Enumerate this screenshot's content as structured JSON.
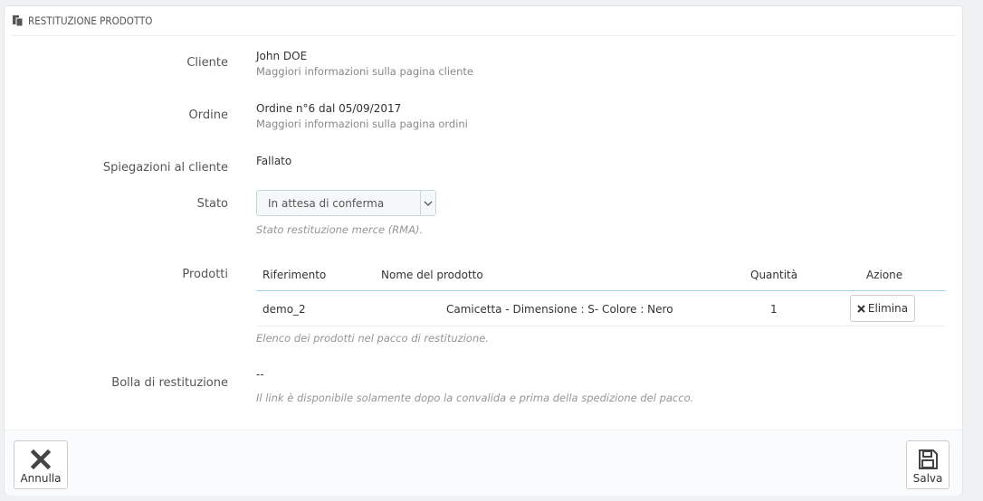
{
  "panel": {
    "title": "RESTITUZIONE PRODOTTO",
    "icon": "copy-icon"
  },
  "customer": {
    "label": "Cliente",
    "name": "John DOE",
    "link": "Maggiori informazioni sulla pagina cliente"
  },
  "order": {
    "label": "Ordine",
    "value": "Ordine n°6 dal 05/09/2017",
    "link": "Maggiori informazioni sulla pagina ordini"
  },
  "explanation": {
    "label": "Spiegazioni al cliente",
    "value": "Fallato"
  },
  "status": {
    "label": "Stato",
    "selected": "In attesa di conferma",
    "help": "Stato restituzione merce (RMA)."
  },
  "products": {
    "label": "Prodotti",
    "columns": [
      "Riferimento",
      "Nome del prodotto",
      "Quantità",
      "Azione"
    ],
    "rows": [
      {
        "reference": "demo_2",
        "name": "Camicetta - Dimensione : S- Colore : Nero",
        "quantity": "1",
        "action": "Elimina"
      }
    ],
    "help": "Elenco dei prodotti nel pacco di restituzione."
  },
  "return_slip": {
    "label": "Bolla di restituzione",
    "value": "--",
    "help": "Il link è disponibile solamente dopo la convalida e prima della spedizione del pacco."
  },
  "footer": {
    "cancel_label": "Annulla",
    "save_label": "Salva"
  },
  "colors": {
    "table_header_border": "#a0d0eb",
    "panel_bg": "#ffffff",
    "page_bg": "#eff1f2"
  }
}
